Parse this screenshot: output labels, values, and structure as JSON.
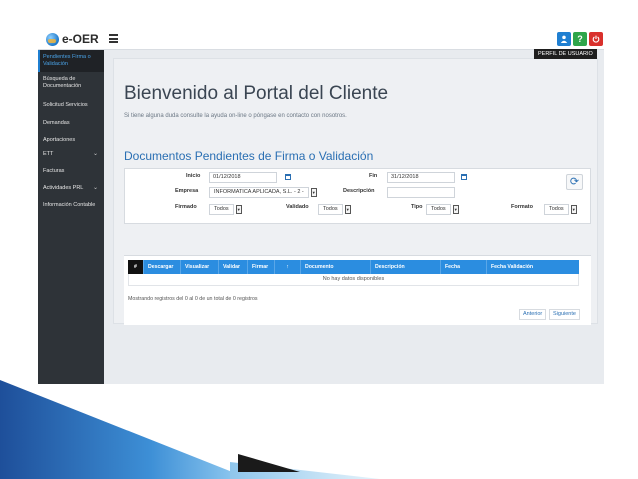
{
  "app": {
    "logo_text": "e-OER",
    "tooltip": "PERFIL DE USUARIO",
    "help_label": "?"
  },
  "sidebar": {
    "items": [
      {
        "label": "Pendientes Firma o Validación",
        "active": true
      },
      {
        "label": "Búsqueda de Documentación"
      },
      {
        "label": "Solicitud Servicios"
      },
      {
        "label": "Demandas"
      },
      {
        "label": "Aportaciones"
      },
      {
        "label": "ETT",
        "caret": "⌄"
      },
      {
        "label": "Facturas"
      },
      {
        "label": "Actividades PRL",
        "caret": "⌄"
      },
      {
        "label": "Información Contable"
      }
    ]
  },
  "main": {
    "title": "Bienvenido al Portal del Cliente",
    "subtitle": "Si tiene alguna duda consulte la ayuda on-line o póngase en contacto con nosotros.",
    "section_title": "Documentos Pendientes de Firma o Validación"
  },
  "filters": {
    "inicio_label": "Inicio",
    "inicio_value": "01/12/2018",
    "fin_label": "Fin",
    "fin_value": "31/12/2018",
    "empresa_label": "Empresa",
    "empresa_value": "INFORMATICA APLICADA, S.L. - 2 -",
    "descripcion_label": "Descripción",
    "descripcion_value": "",
    "firmado_label": "Firmado",
    "firmado_value": "Todos",
    "validado_label": "Validado",
    "validado_value": "Todos",
    "tipo_label": "Tipo",
    "tipo_value": "Todos",
    "formato_label": "Formato",
    "formato_value": "Todos"
  },
  "table": {
    "columns": [
      "#",
      "Descargar",
      "Visualizar",
      "Validar",
      "Firmar",
      "↑",
      "Documento",
      "Descripción",
      "Fecha",
      "Fecha Validación"
    ],
    "empty_text": "No hay datos disponibles",
    "info_text": "Mostrando registros del 0 al 0 de un total de 0 registros",
    "prev_label": "Anterior",
    "next_label": "Siguiente"
  },
  "colors": {
    "accent": "#2b8de0",
    "sidebar_bg": "#2e3338",
    "title_blue": "#2a6fb3"
  }
}
